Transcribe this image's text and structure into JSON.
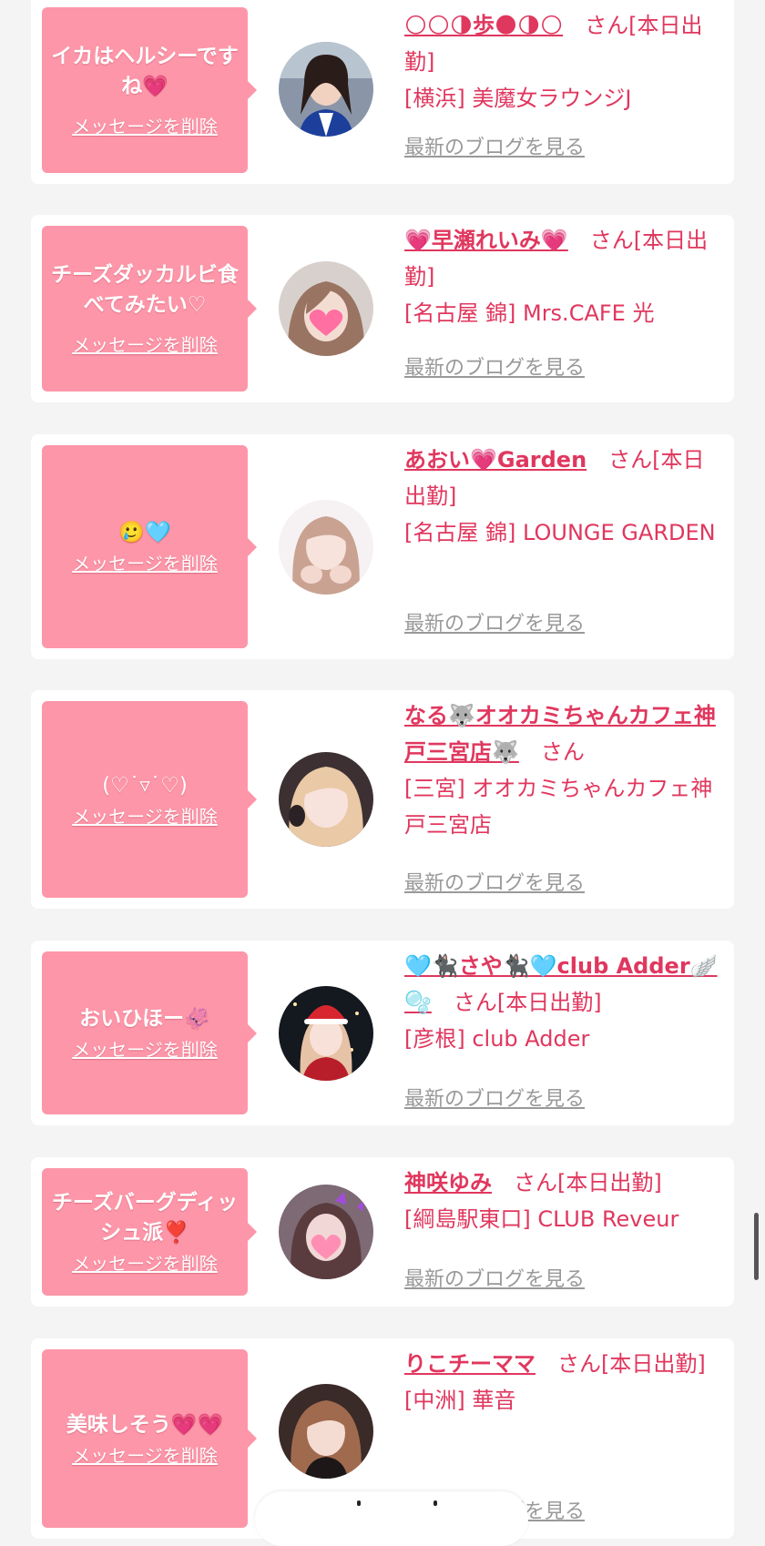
{
  "cards": [
    {
      "message": "イカはヘルシーですね💗",
      "delete_label": "メッセージを削除",
      "name": "🌕🌕🌗歩🌑🌗🌕",
      "suffix": "さん[本日出勤]",
      "shop": "[横浜] 美魔女ラウンジJ",
      "blog_label": "最新のブログを見る",
      "avatar": "avatar-1"
    },
    {
      "message": "チーズダッカルビ食べてみたい♡",
      "delete_label": "メッセージを削除",
      "name": "💗早瀬れいみ💗",
      "suffix": "さん[本日出勤]",
      "shop": "[名古屋 錦] Mrs.CAFE 光",
      "blog_label": "最新のブログを見る",
      "avatar": "avatar-2"
    },
    {
      "message": "🥲🩵",
      "delete_label": "メッセージを削除",
      "name": "あおい💗Garden",
      "suffix": "さん[本日出勤]",
      "shop": "[名古屋 錦] LOUNGE GARDEN",
      "blog_label": "最新のブログを見る",
      "avatar": "avatar-3"
    },
    {
      "message": "(♡˙▿˙♡)",
      "delete_label": "メッセージを削除",
      "name": "なる🐺オオカミちゃんカフェ神戸三宮店🐺",
      "suffix": "さん",
      "shop": "[三宮] オオカミちゃんカフェ神戸三宮店",
      "blog_label": "最新のブログを見る",
      "avatar": "avatar-4"
    },
    {
      "message": "おいひほー🦑",
      "delete_label": "メッセージを削除",
      "name": "🩵🐈‍⬛さや🐈‍⬛🩵club Adder🪽🫧",
      "suffix": "さん[本日出勤]",
      "shop": "[彦根] club Adder",
      "blog_label": "最新のブログを見る",
      "avatar": "avatar-5"
    },
    {
      "message": "チーズバーグディッシュ派❣️",
      "delete_label": "メッセージを削除",
      "name": "神咲ゆみ",
      "suffix": "さん[本日出勤]",
      "shop": "[綱島駅東口] CLUB Reveur",
      "blog_label": "最新のブログを見る",
      "avatar": "avatar-6"
    },
    {
      "message": "美味しそう💗💗",
      "delete_label": "メッセージを削除",
      "name": "りこチーママ",
      "suffix": "さん[本日出勤]",
      "shop": "[中洲] 華音",
      "blog_label": "最新のブログを見る",
      "avatar": "avatar-7"
    }
  ],
  "colors": {
    "accent": "#e0375e",
    "bubble": "#fd96a8",
    "background": "#f4f4f4",
    "blog_link": "#999999"
  }
}
